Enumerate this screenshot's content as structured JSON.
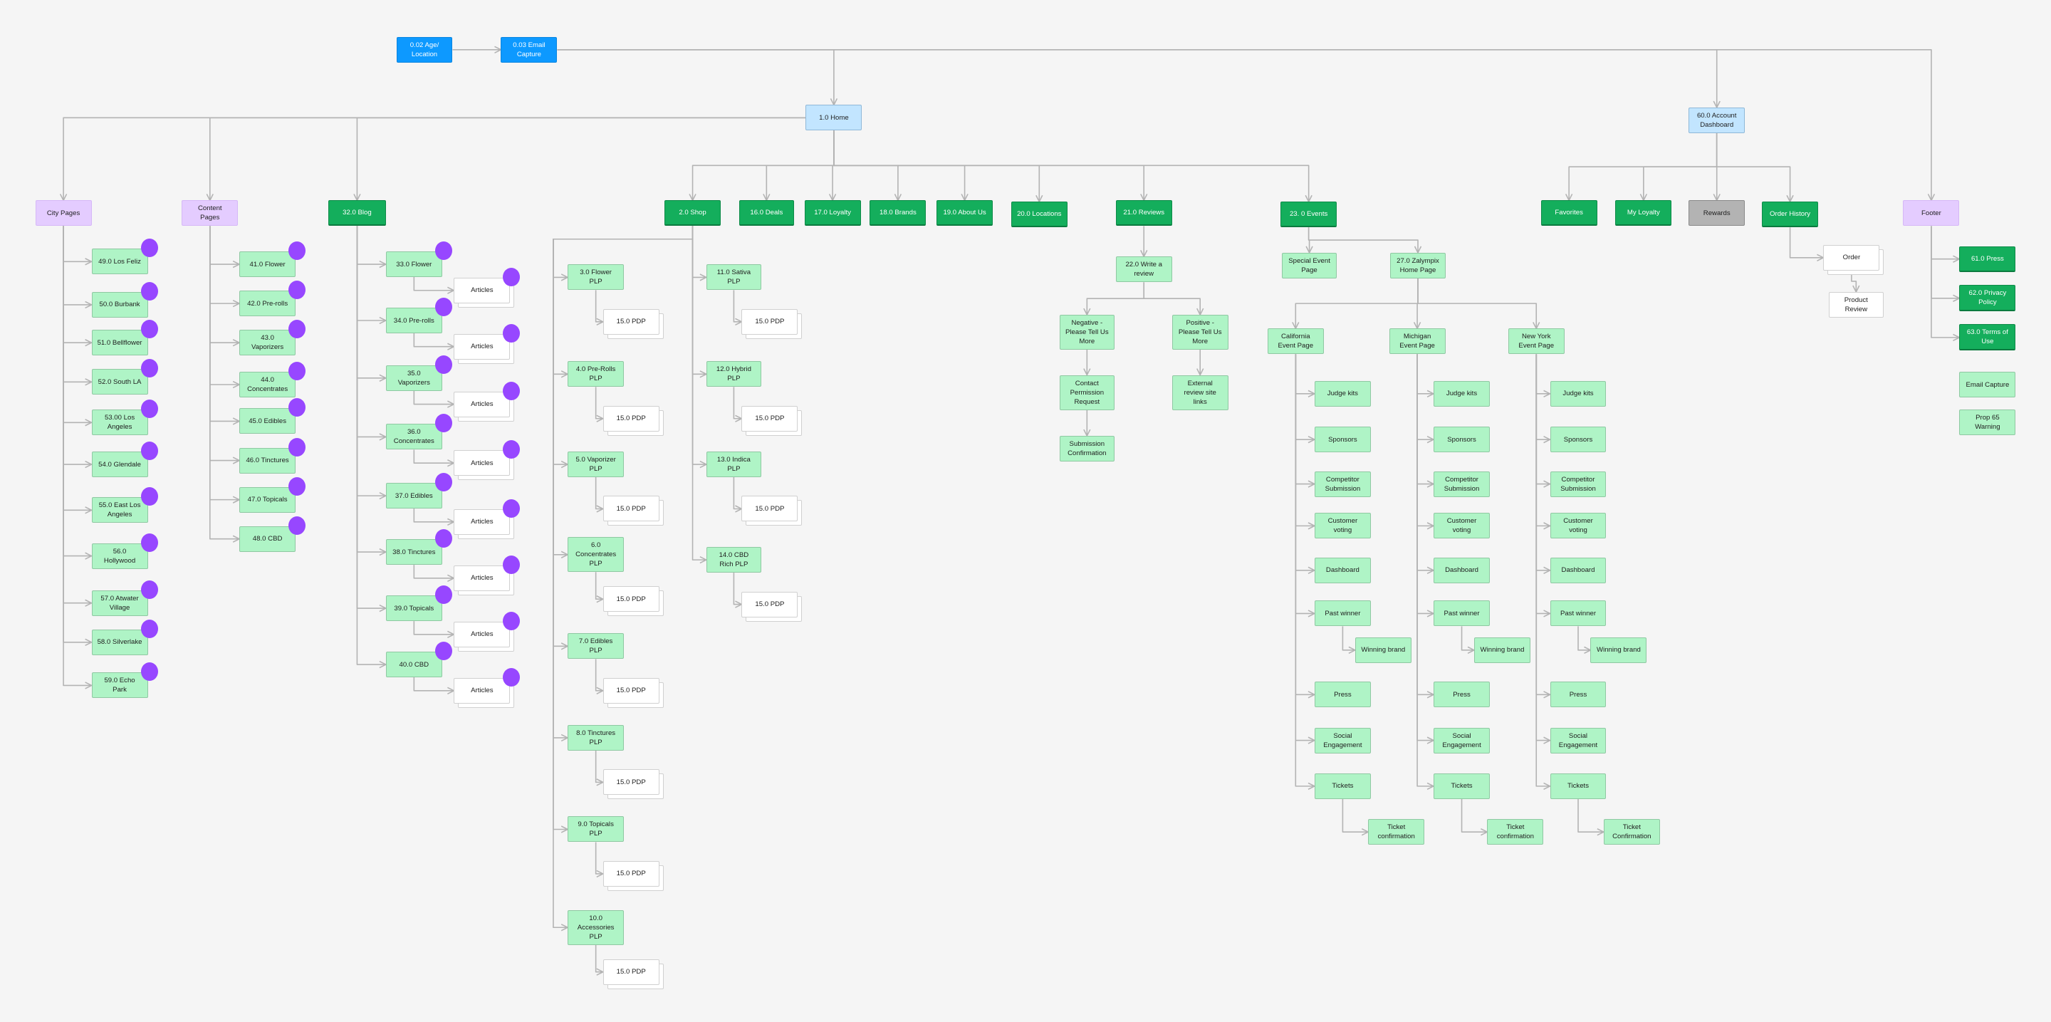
{
  "colors": {
    "entry": "#0d99ff",
    "root": "#c2e5ff",
    "group": "#e4ccff",
    "page": "#14ae5c",
    "sub": "#aff4c6",
    "plain": "#ffffff",
    "disabled": "#b3b3b3",
    "badge": "#9747ff",
    "connector": "#b3b3b3",
    "background": "#f5f5f5"
  },
  "nodes": [
    {
      "id": "age",
      "label": "0.02  Age/ Location",
      "kind": "entry"
    },
    {
      "id": "email",
      "label": "0.03 Email Capture",
      "kind": "entry",
      "parent": "age"
    },
    {
      "id": "home",
      "label": "1.0 Home",
      "kind": "root",
      "parent": "email"
    },
    {
      "id": "account",
      "label": "60.0 Account Dashboard",
      "kind": "root",
      "parent": "email"
    },
    {
      "id": "footer",
      "label": "Footer",
      "kind": "group",
      "parent": "email"
    },
    {
      "id": "city",
      "label": "City Pages",
      "kind": "group",
      "parent": "home"
    },
    {
      "id": "content",
      "label": "Content Pages",
      "kind": "group",
      "parent": "home"
    },
    {
      "id": "blog",
      "label": "32.0 Blog",
      "kind": "page",
      "parent": "home"
    },
    {
      "id": "shop",
      "label": "2.0 Shop",
      "kind": "page",
      "parent": "home"
    },
    {
      "id": "deals",
      "label": "16.0 Deals",
      "kind": "page",
      "parent": "home"
    },
    {
      "id": "loyalty",
      "label": "17.0 Loyalty",
      "kind": "page",
      "parent": "home"
    },
    {
      "id": "brands",
      "label": "18.0 Brands",
      "kind": "page",
      "parent": "home"
    },
    {
      "id": "about",
      "label": "19.0 About Us",
      "kind": "page",
      "parent": "home"
    },
    {
      "id": "locations",
      "label": "20.0 Locations",
      "kind": "page",
      "parent": "home"
    },
    {
      "id": "reviews",
      "label": "21.0 Reviews",
      "kind": "page",
      "parent": "home"
    },
    {
      "id": "events",
      "label": "23. 0 Events",
      "kind": "page",
      "parent": "home"
    },
    {
      "id": "city1",
      "label": "49.0 Los Feliz",
      "kind": "sub",
      "parent": "city",
      "badge": true
    },
    {
      "id": "city2",
      "label": "50.0 Burbank",
      "kind": "sub",
      "parent": "city",
      "badge": true
    },
    {
      "id": "city3",
      "label": "51.0 Bellflower",
      "kind": "sub",
      "parent": "city",
      "badge": true
    },
    {
      "id": "city4",
      "label": "52.0 South LA",
      "kind": "sub",
      "parent": "city",
      "badge": true
    },
    {
      "id": "city5",
      "label": "53.00 Los Angeles",
      "kind": "sub",
      "parent": "city",
      "badge": true
    },
    {
      "id": "city6",
      "label": "54.0 Glendale",
      "kind": "sub",
      "parent": "city",
      "badge": true
    },
    {
      "id": "city7",
      "label": "55.0 East Los Angeles",
      "kind": "sub",
      "parent": "city",
      "badge": true
    },
    {
      "id": "city8",
      "label": "56.0 Hollywood",
      "kind": "sub",
      "parent": "city",
      "badge": true
    },
    {
      "id": "city9",
      "label": "57.0 Atwater Village",
      "kind": "sub",
      "parent": "city",
      "badge": true
    },
    {
      "id": "city10",
      "label": "58.0 Silverlake",
      "kind": "sub",
      "parent": "city",
      "badge": true
    },
    {
      "id": "city11",
      "label": "59.0 Echo Park",
      "kind": "sub",
      "parent": "city",
      "badge": true
    },
    {
      "id": "cont1",
      "label": "41.0 Flower",
      "kind": "sub",
      "parent": "content",
      "badge": true
    },
    {
      "id": "cont2",
      "label": "42.0 Pre-rolls",
      "kind": "sub",
      "parent": "content",
      "badge": true
    },
    {
      "id": "cont3",
      "label": "43.0 Vaporizers",
      "kind": "sub",
      "parent": "content",
      "badge": true
    },
    {
      "id": "cont4",
      "label": "44.0 Concentrates",
      "kind": "sub",
      "parent": "content",
      "badge": true
    },
    {
      "id": "cont5",
      "label": "45.0 Edibles",
      "kind": "sub",
      "parent": "content",
      "badge": true
    },
    {
      "id": "cont6",
      "label": "46.0 Tinctures",
      "kind": "sub",
      "parent": "content",
      "badge": true
    },
    {
      "id": "cont7",
      "label": "47.0 Topicals",
      "kind": "sub",
      "parent": "content",
      "badge": true
    },
    {
      "id": "cont8",
      "label": "48.0 CBD",
      "kind": "sub",
      "parent": "content",
      "badge": true
    },
    {
      "id": "blog1",
      "label": "33.0 Flower",
      "kind": "sub",
      "parent": "blog",
      "badge": true
    },
    {
      "id": "blog2",
      "label": "34.0 Pre-rolls",
      "kind": "sub",
      "parent": "blog",
      "badge": true
    },
    {
      "id": "blog3",
      "label": "35.0 Vaporizers",
      "kind": "sub",
      "parent": "blog",
      "badge": true
    },
    {
      "id": "blog4",
      "label": "36.0 Concentrates",
      "kind": "sub",
      "parent": "blog",
      "badge": true
    },
    {
      "id": "blog5",
      "label": "37.0 Edibles",
      "kind": "sub",
      "parent": "blog",
      "badge": true
    },
    {
      "id": "blog6",
      "label": "38.0 Tinctures",
      "kind": "sub",
      "parent": "blog",
      "badge": true
    },
    {
      "id": "blog7",
      "label": "39.0 Topicals",
      "kind": "sub",
      "parent": "blog",
      "badge": true
    },
    {
      "id": "blog8",
      "label": "40.0 CBD",
      "kind": "sub",
      "parent": "blog",
      "badge": true
    },
    {
      "id": "art1",
      "label": "Articles",
      "kind": "plain",
      "parent": "blog1",
      "badge": true,
      "stack": true
    },
    {
      "id": "art2",
      "label": "Articles",
      "kind": "plain",
      "parent": "blog2",
      "badge": true,
      "stack": true
    },
    {
      "id": "art3",
      "label": "Articles",
      "kind": "plain",
      "parent": "blog3",
      "badge": true,
      "stack": true
    },
    {
      "id": "art4",
      "label": "Articles",
      "kind": "plain",
      "parent": "blog4",
      "badge": true,
      "stack": true
    },
    {
      "id": "art5",
      "label": "Articles",
      "kind": "plain",
      "parent": "blog5",
      "badge": true,
      "stack": true
    },
    {
      "id": "art6",
      "label": "Articles",
      "kind": "plain",
      "parent": "blog6",
      "badge": true,
      "stack": true
    },
    {
      "id": "art7",
      "label": "Articles",
      "kind": "plain",
      "parent": "blog7",
      "badge": true,
      "stack": true
    },
    {
      "id": "art8",
      "label": "Articles",
      "kind": "plain",
      "parent": "blog8",
      "badge": true,
      "stack": true
    },
    {
      "id": "plp3",
      "label": "3.0 Flower PLP",
      "kind": "sub",
      "parent": "shop"
    },
    {
      "id": "plp4",
      "label": "4.0 Pre-Rolls PLP",
      "kind": "sub",
      "parent": "shop"
    },
    {
      "id": "plp5",
      "label": "5.0 Vaporizer PLP",
      "kind": "sub",
      "parent": "shop"
    },
    {
      "id": "plp6",
      "label": "6.0 Concentrates PLP",
      "kind": "sub",
      "parent": "shop"
    },
    {
      "id": "plp7",
      "label": "7.0 Edibles PLP",
      "kind": "sub",
      "parent": "shop"
    },
    {
      "id": "plp8",
      "label": "8.0 Tinctures PLP",
      "kind": "sub",
      "parent": "shop"
    },
    {
      "id": "plp9",
      "label": "9.0 Topicals PLP",
      "kind": "sub",
      "parent": "shop"
    },
    {
      "id": "plp10",
      "label": "10.0 Accessories PLP",
      "kind": "sub",
      "parent": "shop"
    },
    {
      "id": "plp11",
      "label": "11.0 Sativa PLP",
      "kind": "sub",
      "parent": "shop"
    },
    {
      "id": "plp12",
      "label": "12.0 Hybrid PLP",
      "kind": "sub",
      "parent": "shop"
    },
    {
      "id": "plp13",
      "label": "13.0 Indica PLP",
      "kind": "sub",
      "parent": "shop"
    },
    {
      "id": "plp14",
      "label": "14.0 CBD Rich PLP",
      "kind": "sub",
      "parent": "shop"
    },
    {
      "id": "pdp3",
      "label": "15.0 PDP",
      "kind": "plain",
      "parent": "plp3",
      "stack": true
    },
    {
      "id": "pdp4",
      "label": "15.0 PDP",
      "kind": "plain",
      "parent": "plp4",
      "stack": true
    },
    {
      "id": "pdp5",
      "label": "15.0 PDP",
      "kind": "plain",
      "parent": "plp5",
      "stack": true
    },
    {
      "id": "pdp6",
      "label": "15.0 PDP",
      "kind": "plain",
      "parent": "plp6",
      "stack": true
    },
    {
      "id": "pdp7",
      "label": "15.0 PDP",
      "kind": "plain",
      "parent": "plp7",
      "stack": true
    },
    {
      "id": "pdp8",
      "label": "15.0 PDP",
      "kind": "plain",
      "parent": "plp8",
      "stack": true
    },
    {
      "id": "pdp9",
      "label": "15.0 PDP",
      "kind": "plain",
      "parent": "plp9",
      "stack": true
    },
    {
      "id": "pdp10",
      "label": "15.0 PDP",
      "kind": "plain",
      "parent": "plp10",
      "stack": true
    },
    {
      "id": "pdp11",
      "label": "15.0 PDP",
      "kind": "plain",
      "parent": "plp11",
      "stack": true
    },
    {
      "id": "pdp12",
      "label": "15.0 PDP",
      "kind": "plain",
      "parent": "plp12",
      "stack": true
    },
    {
      "id": "pdp13",
      "label": "15.0 PDP",
      "kind": "plain",
      "parent": "plp13",
      "stack": true
    },
    {
      "id": "pdp14",
      "label": "15.0 PDP",
      "kind": "plain",
      "parent": "plp14",
      "stack": true
    },
    {
      "id": "write",
      "label": "22.0 Write a review",
      "kind": "sub",
      "parent": "reviews"
    },
    {
      "id": "neg",
      "label": "Negative - Please Tell Us More",
      "kind": "sub",
      "parent": "write"
    },
    {
      "id": "pos",
      "label": "Positive - Please Tell Us More",
      "kind": "sub",
      "parent": "write"
    },
    {
      "id": "contact",
      "label": "Contact Permission Request",
      "kind": "sub",
      "parent": "neg"
    },
    {
      "id": "submit",
      "label": "Submission Confirmation",
      "kind": "sub",
      "parent": "contact"
    },
    {
      "id": "external",
      "label": "External review site links",
      "kind": "sub",
      "parent": "pos"
    },
    {
      "id": "special",
      "label": "Special Event Page",
      "kind": "sub",
      "parent": "events"
    },
    {
      "id": "zal",
      "label": "27.0 Zalympix Home Page",
      "kind": "sub",
      "parent": "events"
    },
    {
      "id": "ca",
      "label": "California Event Page",
      "kind": "sub",
      "parent": "zal"
    },
    {
      "id": "mi",
      "label": "Michigan Event Page",
      "kind": "sub",
      "parent": "zal"
    },
    {
      "id": "ny",
      "label": "New York Event Page",
      "kind": "sub",
      "parent": "zal"
    },
    {
      "id": "ca1",
      "label": "Judge kits",
      "kind": "sub",
      "parent": "ca"
    },
    {
      "id": "ca2",
      "label": "Sponsors",
      "kind": "sub",
      "parent": "ca"
    },
    {
      "id": "ca3",
      "label": "Competitor Submission",
      "kind": "sub",
      "parent": "ca"
    },
    {
      "id": "ca4",
      "label": "Customer voting",
      "kind": "sub",
      "parent": "ca"
    },
    {
      "id": "ca5",
      "label": "Dashboard",
      "kind": "sub",
      "parent": "ca"
    },
    {
      "id": "ca6",
      "label": "Past winner",
      "kind": "sub",
      "parent": "ca"
    },
    {
      "id": "ca7",
      "label": "Press",
      "kind": "sub",
      "parent": "ca"
    },
    {
      "id": "ca8",
      "label": "Social Engagement",
      "kind": "sub",
      "parent": "ca"
    },
    {
      "id": "ca9",
      "label": "Tickets",
      "kind": "sub",
      "parent": "ca"
    },
    {
      "id": "caw",
      "label": "Winning brand",
      "kind": "sub",
      "parent": "ca6"
    },
    {
      "id": "cat",
      "label": "Ticket confirmation",
      "kind": "sub",
      "parent": "ca9"
    },
    {
      "id": "mi1",
      "label": "Judge kits",
      "kind": "sub",
      "parent": "mi"
    },
    {
      "id": "mi2",
      "label": "Sponsors",
      "kind": "sub",
      "parent": "mi"
    },
    {
      "id": "mi3",
      "label": "Competitor Submission",
      "kind": "sub",
      "parent": "mi"
    },
    {
      "id": "mi4",
      "label": "Customer voting",
      "kind": "sub",
      "parent": "mi"
    },
    {
      "id": "mi5",
      "label": "Dashboard",
      "kind": "sub",
      "parent": "mi"
    },
    {
      "id": "mi6",
      "label": "Past winner",
      "kind": "sub",
      "parent": "mi"
    },
    {
      "id": "mi7",
      "label": "Press",
      "kind": "sub",
      "parent": "mi"
    },
    {
      "id": "mi8",
      "label": "Social Engagement",
      "kind": "sub",
      "parent": "mi"
    },
    {
      "id": "mi9",
      "label": "Tickets",
      "kind": "sub",
      "parent": "mi"
    },
    {
      "id": "miw",
      "label": "Winning brand",
      "kind": "sub",
      "parent": "mi6"
    },
    {
      "id": "mit",
      "label": "Ticket confirmation",
      "kind": "sub",
      "parent": "mi9"
    },
    {
      "id": "ny1",
      "label": "Judge kits",
      "kind": "sub",
      "parent": "ny"
    },
    {
      "id": "ny2",
      "label": "Sponsors",
      "kind": "sub",
      "parent": "ny"
    },
    {
      "id": "ny3",
      "label": "Competitor Submission",
      "kind": "sub",
      "parent": "ny"
    },
    {
      "id": "ny4",
      "label": "Customer voting",
      "kind": "sub",
      "parent": "ny"
    },
    {
      "id": "ny5",
      "label": "Dashboard",
      "kind": "sub",
      "parent": "ny"
    },
    {
      "id": "ny6",
      "label": "Past winner",
      "kind": "sub",
      "parent": "ny"
    },
    {
      "id": "ny7",
      "label": "Press",
      "kind": "sub",
      "parent": "ny"
    },
    {
      "id": "ny8",
      "label": "Social Engagement",
      "kind": "sub",
      "parent": "ny"
    },
    {
      "id": "ny9",
      "label": "Tickets",
      "kind": "sub",
      "parent": "ny"
    },
    {
      "id": "nyw",
      "label": "Winning brand",
      "kind": "sub",
      "parent": "ny6"
    },
    {
      "id": "nyt",
      "label": "Ticket Confirmation",
      "kind": "sub",
      "parent": "ny9"
    },
    {
      "id": "favorites",
      "label": "Favorites",
      "kind": "page",
      "parent": "account"
    },
    {
      "id": "myloyalty",
      "label": "My Loyalty",
      "kind": "page",
      "parent": "account"
    },
    {
      "id": "rewards",
      "label": "Rewards",
      "kind": "disabled",
      "parent": "account"
    },
    {
      "id": "orderhist",
      "label": "Order History",
      "kind": "page",
      "parent": "account"
    },
    {
      "id": "order",
      "label": "Order",
      "kind": "plain",
      "parent": "orderhist",
      "stack": true
    },
    {
      "id": "prodreview",
      "label": "Product Review",
      "kind": "plain",
      "parent": "order"
    },
    {
      "id": "press",
      "label": "61.0 Press",
      "kind": "page",
      "parent": "footer"
    },
    {
      "id": "privacy",
      "label": "62.0 Privacy Policy",
      "kind": "page",
      "parent": "footer"
    },
    {
      "id": "terms",
      "label": "63.0 Terms of Use",
      "kind": "page",
      "parent": "footer"
    },
    {
      "id": "emailcap",
      "label": "Email Capture",
      "kind": "sub"
    },
    {
      "id": "prop65",
      "label": "Prop 65 Warning",
      "kind": "sub"
    }
  ]
}
